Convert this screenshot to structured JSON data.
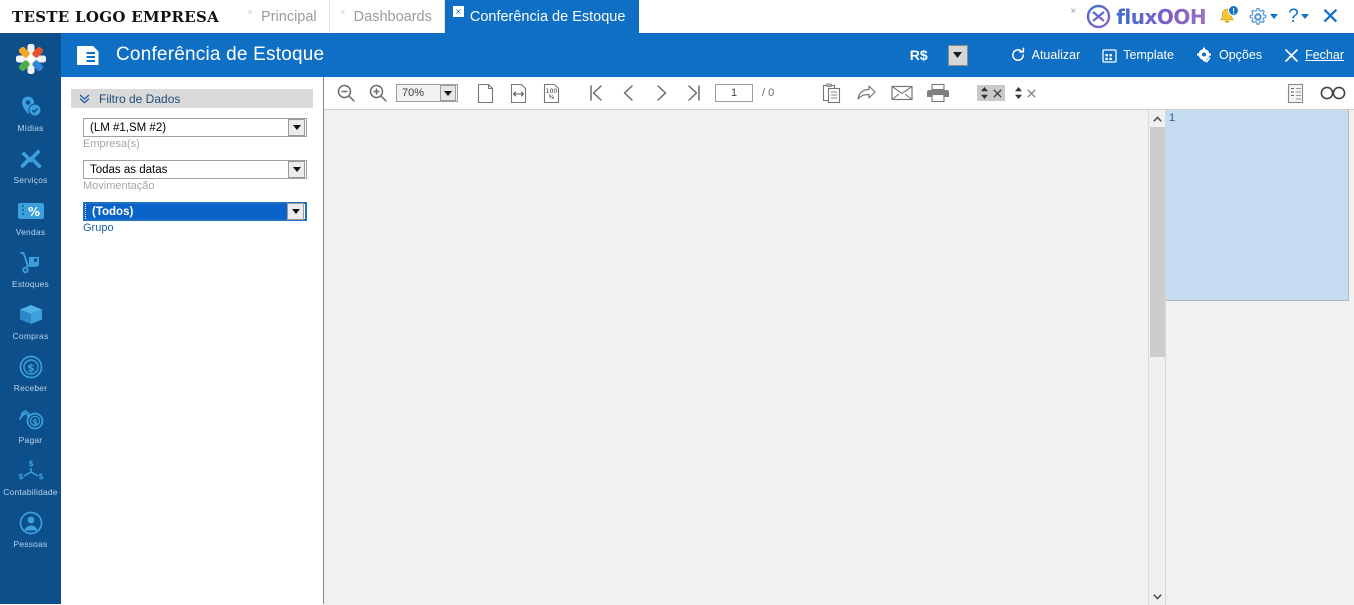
{
  "topbar": {
    "brand": "TESTE LOGO EMPRESA",
    "tabs": [
      {
        "label": "Principal",
        "close": "×",
        "active": false
      },
      {
        "label": "Dashboards",
        "close": "×",
        "active": false
      },
      {
        "label": "Conferência de Estoque",
        "close": "×",
        "active": true
      }
    ],
    "extra_close": "×",
    "product_name": "fluxOOH",
    "product_icon": "flux-circle-logo-icon",
    "bell_icon": "notification-bell-icon",
    "bell_badge": "!",
    "gear_icon": "gear-icon",
    "help_label": "?",
    "close_icon": "close-icon",
    "accent": "#1273c7"
  },
  "sidebar": {
    "logo_icon": "app-flower-logo-icon",
    "bg": "#0d4f8b",
    "items": [
      {
        "label": "Mídias",
        "icon": "map-pin-check-icon"
      },
      {
        "label": "Serviços",
        "icon": "tools-wrench-screwdriver-icon"
      },
      {
        "label": "Vendas",
        "icon": "percent-tag-icon"
      },
      {
        "label": "Estoques",
        "icon": "hand-truck-icon"
      },
      {
        "label": "Compras",
        "icon": "box-package-icon"
      },
      {
        "label": "Receber",
        "icon": "dollar-coin-icon"
      },
      {
        "label": "Pagar",
        "icon": "hand-coin-icon"
      },
      {
        "label": "Contabilidade",
        "icon": "accounting-tree-icon"
      },
      {
        "label": "Pessoas",
        "icon": "person-circle-icon"
      }
    ]
  },
  "header": {
    "icon": "report-document-icon",
    "title": "Conferência de Estoque",
    "bg": "#0f6fc5",
    "currency": "R$",
    "currency_dropdown_icon": "chevron-down-icon",
    "buttons": [
      {
        "label": "Atualizar",
        "icon": "refresh-icon"
      },
      {
        "label": "Template",
        "icon": "template-grid-icon"
      },
      {
        "label": "Opções",
        "icon": "gear-check-icon"
      },
      {
        "label": "Fechar",
        "icon": "close-x-icon"
      }
    ]
  },
  "filter": {
    "collapse_icon": "chevron-double-down-icon",
    "title": "Filtro de Dados",
    "fields": [
      {
        "value": "(LM #1,SM #2)",
        "caption": "Empresa(s)",
        "selected": false
      },
      {
        "value": "Todas as datas",
        "caption": "Movimentação",
        "selected": false
      },
      {
        "value": "(Todos)",
        "caption": "Grupo",
        "selected": true
      }
    ]
  },
  "report_toolbar": {
    "zoom_out_icon": "zoom-out-icon",
    "zoom_in_icon": "zoom-in-icon",
    "zoom_value": "70%",
    "zoom_dropdown_icon": "chevron-down-icon",
    "whole_page_icon": "whole-page-icon",
    "page_width_icon": "page-width-icon",
    "actual_size_icon": "actual-size-100-icon",
    "first_page_icon": "first-page-icon",
    "prev_page_icon": "prev-page-icon",
    "next_page_icon": "next-page-icon",
    "last_page_icon": "last-page-icon",
    "page_number": "1",
    "page_total": "/ 0",
    "copy_icon": "copy-clipboard-icon",
    "export_icon": "export-share-icon",
    "email_icon": "email-envelope-icon",
    "print_icon": "printer-icon",
    "spin_icon": "updown-spinner-icon",
    "spin_close_icon": "close-small-icon",
    "outline_icon": "thumbnails-outline-icon",
    "find_icon": "binoculars-find-icon"
  },
  "viewer": {
    "scroll_up_icon": "chevron-up-icon",
    "scroll_down_icon": "chevron-down-icon",
    "thumbnail_page_label": "1",
    "thumbnail_selected_color": "#c6dcf1"
  }
}
